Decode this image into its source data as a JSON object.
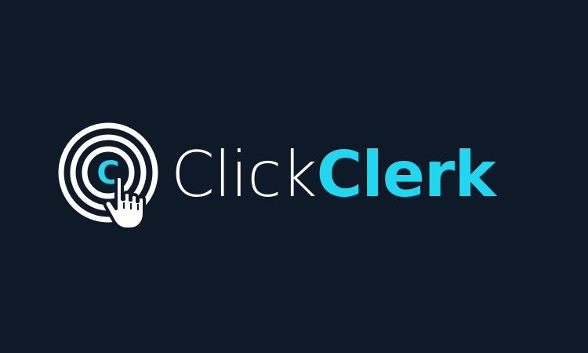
{
  "brand": {
    "name_part_1": "Click",
    "name_part_2": "Clerk",
    "mark_letter": "C"
  },
  "colors": {
    "background": "#0e1a28",
    "primary_text": "#ffffff",
    "accent": "#22d6f0"
  },
  "icons": {
    "logo_mark": "concentric-rings-pointer-hand-icon"
  }
}
